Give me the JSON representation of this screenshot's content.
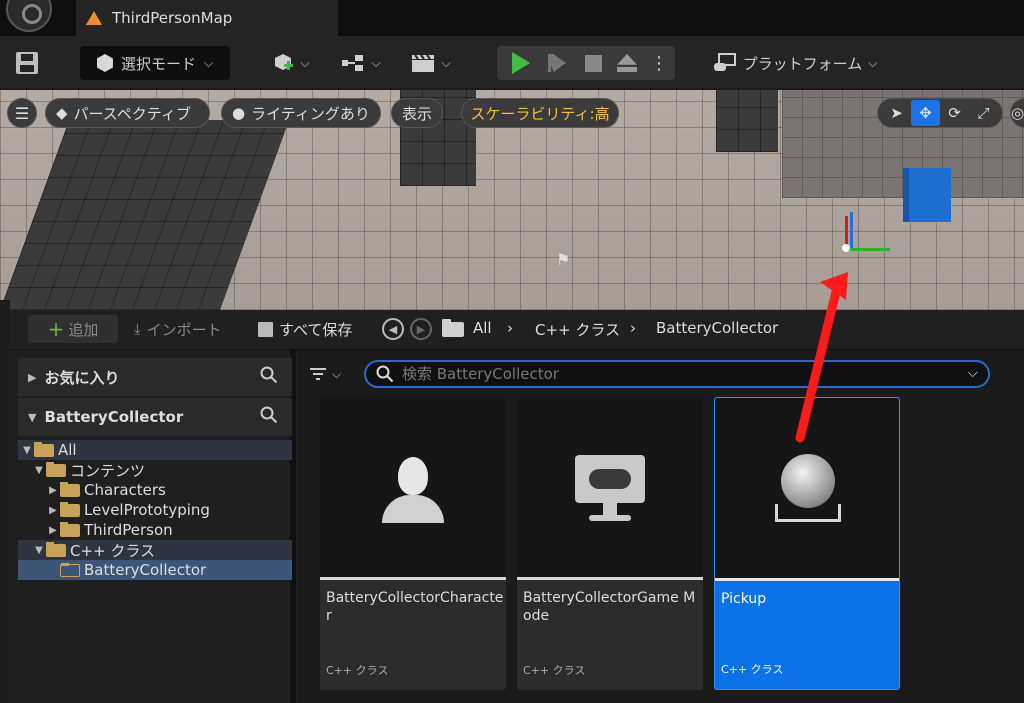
{
  "title_bar": {
    "map_tab": "ThirdPersonMap"
  },
  "toolbar": {
    "mode_label": "選択モード",
    "platform_label": "プラットフォーム"
  },
  "viewport": {
    "perspective": "パースペクティブ",
    "lighting": "ライティングあり",
    "show": "表示",
    "scalability": "スケーラビリティ:高"
  },
  "content_browser": {
    "add_label": "追加",
    "import_label": "インポート",
    "save_all_label": "すべて保存",
    "breadcrumb": [
      "All",
      "C++ クラス",
      "BatteryCollector"
    ],
    "search_placeholder": "検索 BatteryCollector",
    "sources": {
      "favorites_header": "お気に入り",
      "project_header": "BatteryCollector",
      "tree": [
        {
          "label": "All",
          "depth": 0,
          "expanded": true
        },
        {
          "label": "コンテンツ",
          "depth": 1,
          "expanded": true
        },
        {
          "label": "Characters",
          "depth": 2,
          "expanded": false
        },
        {
          "label": "LevelPrototyping",
          "depth": 2,
          "expanded": false
        },
        {
          "label": "ThirdPerson",
          "depth": 2,
          "expanded": false
        },
        {
          "label": "C++ クラス",
          "depth": 1,
          "expanded": true
        },
        {
          "label": "BatteryCollector",
          "depth": 2,
          "expanded": false
        }
      ]
    },
    "assets": [
      {
        "name": "BatteryCollectorCharacter",
        "type": "C++ クラス"
      },
      {
        "name": "BatteryCollectorGame Mode",
        "type": "C++ クラス"
      },
      {
        "name": "Pickup",
        "type": "C++ クラス"
      }
    ]
  },
  "colors": {
    "accent_blue": "#0a72e6",
    "play_green": "#3fbf3f",
    "scalability_yellow": "#f0c040",
    "annotation_red": "#ff0000"
  }
}
